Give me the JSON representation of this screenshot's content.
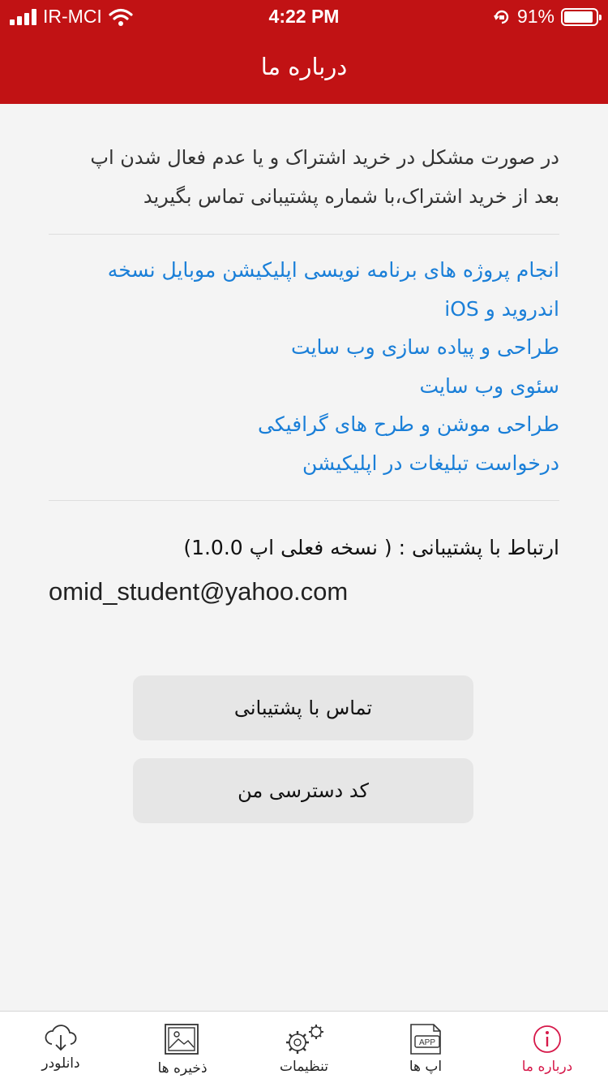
{
  "status_bar": {
    "carrier": "IR-MCI",
    "time": "4:22 PM",
    "battery_percent": "91%",
    "battery_level": 0.91
  },
  "header": {
    "title": "درباره ما"
  },
  "notice": {
    "line1": "در صورت مشکل در خرید اشتراک و یا عدم فعال شدن اپ",
    "line2": "بعد از خرید اشتراک،با شماره پشتیبانی تماس بگیرید"
  },
  "services": {
    "items": [
      "انجام پروژه های برنامه نویسی اپلیکیشن موبایل نسخه",
      "اندروید و iOS",
      "طراحی و پیاده سازی وب سایت",
      "سئوی وب سایت",
      "طراحی موشن و طرح های گرافیکی",
      "درخواست تبلیغات در اپلیکیشن"
    ]
  },
  "support": {
    "title": "ارتباط با پشتیبانی : ( نسخه فعلی اپ 1.0.0)",
    "email": "omid_student@yahoo.com"
  },
  "buttons": {
    "contact_support": "تماس با پشتیبانی",
    "my_access_code": "کد دسترسی من"
  },
  "tab_bar": {
    "items": [
      {
        "label": "دانلودر",
        "icon": "cloud-download-icon"
      },
      {
        "label": "ذخیره ها",
        "icon": "gallery-icon"
      },
      {
        "label": "تنظیمات",
        "icon": "gears-icon"
      },
      {
        "label": "اپ ها",
        "icon": "app-icon"
      },
      {
        "label": "درباره ما",
        "icon": "info-icon"
      }
    ],
    "active": "درباره ما"
  },
  "colors": {
    "brand": "#c11214",
    "link": "#1a7fd8",
    "active_tab": "#d6194a"
  }
}
